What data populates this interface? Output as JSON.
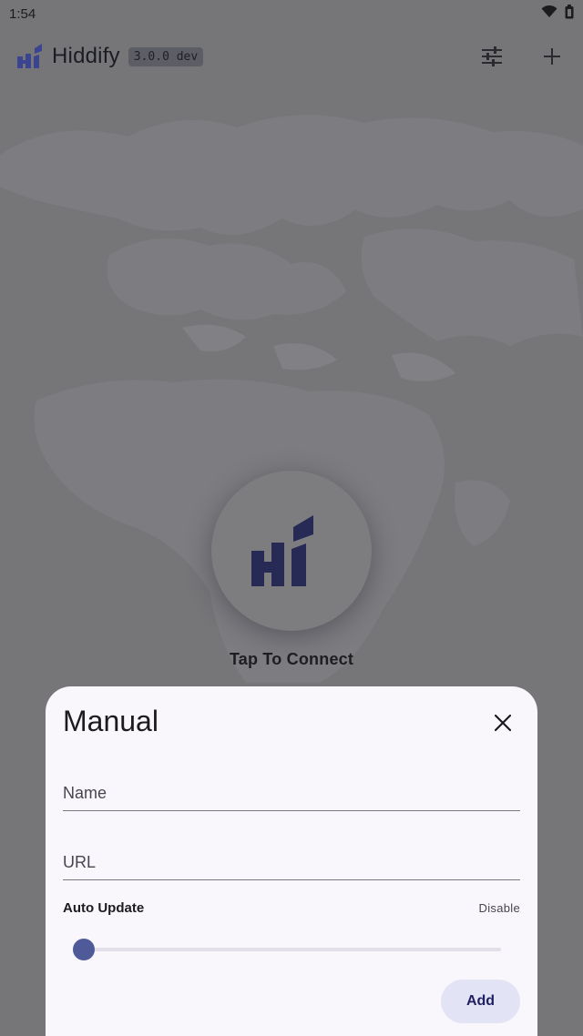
{
  "status_bar": {
    "time": "1:54",
    "wifi_icon": "wifi-icon",
    "battery_icon": "battery-icon"
  },
  "app_bar": {
    "title": "Hiddify",
    "version": "3.0.0 dev",
    "filter_icon": "tune-icon",
    "add_icon": "plus-icon"
  },
  "connect": {
    "label": "Tap To Connect"
  },
  "sheet": {
    "title": "Manual",
    "name_field": {
      "placeholder": "Name",
      "value": ""
    },
    "url_field": {
      "placeholder": "URL",
      "value": ""
    },
    "auto_update": {
      "label": "Auto Update",
      "value": "Disable",
      "slider_level": 0
    },
    "add_label": "Add"
  },
  "colors": {
    "accent": "#4f5a98",
    "logo": "#272a55",
    "sheet_bg": "#f9f6fc",
    "scrim": "#767679"
  }
}
